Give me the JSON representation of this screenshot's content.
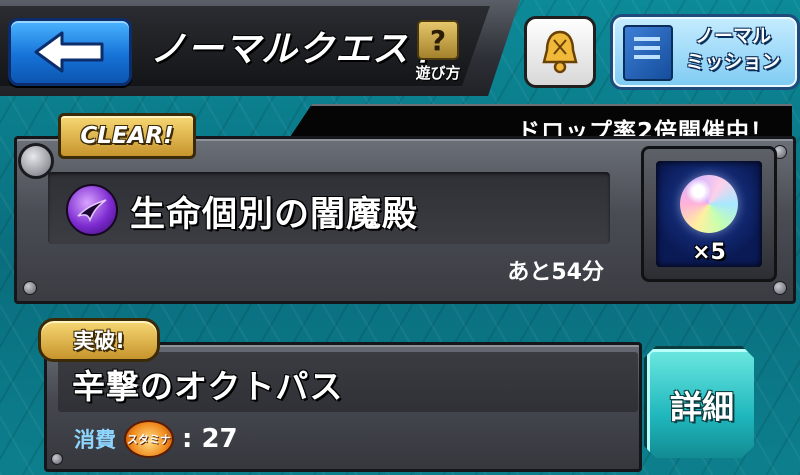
{
  "header": {
    "title": "ノーマルクエスト",
    "howto_label": "遊び方",
    "howto_symbol": "?",
    "mission_label_line1": "ノーマル",
    "mission_label_line2": "ミッション"
  },
  "banner": {
    "drop_rate_text": "ドロップ率2倍開催中！"
  },
  "quest": {
    "status_badge": "CLEAR!",
    "name": "生命個別の闇魔殿",
    "element": "dark",
    "time_remaining": "あと54分",
    "reward_icon": "rainbow-orb-icon",
    "reward_count": "×5"
  },
  "stage": {
    "badge": "実破!",
    "name": "辛撃のオクトパス",
    "cost_label": "消費",
    "stamina_label": "スタミナ",
    "cost_value": ": 27",
    "detail_button": "詳細"
  },
  "colors": {
    "background": "#0e7c8c",
    "back_button": "#1673d8",
    "badge_gold": "#e0b447",
    "detail_button": "#1fb7bd",
    "cost_label": "#8fd6ff"
  }
}
